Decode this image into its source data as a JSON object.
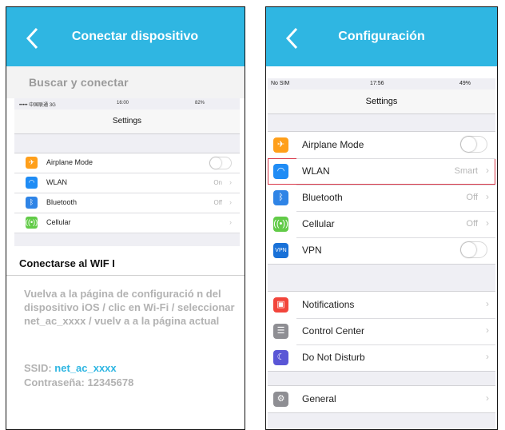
{
  "left": {
    "title": "Conectar dispositivo",
    "subtitle": "Buscar y conectar",
    "mini_settings": {
      "carrier": "••••• 中国联通  3G",
      "time": "16:00",
      "battery": "82%",
      "title": "Settings",
      "rows": [
        {
          "label": "Airplane Mode",
          "value": "",
          "icon": "airplane-icon"
        },
        {
          "label": "WLAN",
          "value": "On",
          "icon": "wifi-icon"
        },
        {
          "label": "Bluetooth",
          "value": "Off",
          "icon": "bluetooth-icon"
        },
        {
          "label": "Cellular",
          "value": "",
          "icon": "cellular-icon"
        }
      ]
    },
    "section_heading": "Conectarse al WIF I",
    "instructions": "Vuelva a la página de configuració n del dispositivo iOS / clic en Wi-Fi / seleccionar net_ac_xxxx / vuelv a a la página actual",
    "ssid_label": "SSID:",
    "ssid_value": "net_ac_xxxx",
    "password_line": "Contraseña: 12345678"
  },
  "right": {
    "title": "Configuración",
    "status": {
      "carrier": "No SIM",
      "time": "17:56",
      "battery": "49%"
    },
    "settings_title": "Settings",
    "group1": [
      {
        "label": "Airplane Mode",
        "value": "",
        "icon": "airplane-icon"
      },
      {
        "label": "WLAN",
        "value": "Smart",
        "icon": "wifi-icon"
      },
      {
        "label": "Bluetooth",
        "value": "Off",
        "icon": "bluetooth-icon"
      },
      {
        "label": "Cellular",
        "value": "Off",
        "icon": "cellular-icon"
      },
      {
        "label": "VPN",
        "value": "",
        "icon": "vpn-icon",
        "icon_text": "VPN"
      }
    ],
    "group2": [
      {
        "label": "Notifications",
        "icon": "notifications-icon"
      },
      {
        "label": "Control Center",
        "icon": "control-center-icon"
      },
      {
        "label": "Do Not Disturb",
        "icon": "moon-icon"
      }
    ],
    "group3": [
      {
        "label": "General",
        "icon": "gear-icon"
      }
    ]
  },
  "colors": {
    "accent": "#2fb6e2",
    "highlight": "#d9394a"
  }
}
